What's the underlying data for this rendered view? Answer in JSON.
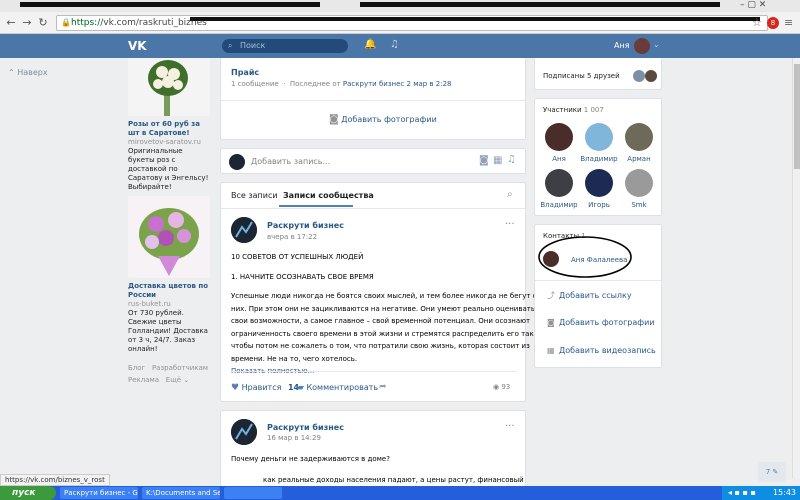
{
  "browser": {
    "url_host": "vk.com",
    "url_path": "/raskruti_biznes",
    "url_scheme": "https://",
    "ext_badge": "8"
  },
  "vk_header": {
    "logo": "VK",
    "search_placeholder": "Поиск",
    "user_name": "Аня"
  },
  "left": {
    "back_label": "Наверх",
    "ads": [
      {
        "title": "Розы от 60 руб за шт в Саратове!",
        "domain": "mirovetov-saratov.ru",
        "text": "Оригинальные букеты роз с доставкой по Саратову и Энгельсу! Выбирайте!"
      },
      {
        "title": "Доставка цветов по России",
        "domain": "rus-buket.ru",
        "text": "От 730 рублей. Свежие цветы Голландии! Доставка от 3 ч, 24/7. Заказ онлайн!"
      }
    ],
    "links": {
      "blog": "Блог",
      "devs": "Разработчикам",
      "ads": "Реклама",
      "more": "Ещё ⌄"
    }
  },
  "center": {
    "topic_card": {
      "title": "Прайс",
      "meta_count": "1 сообщение",
      "meta_last": "Последнее от",
      "meta_author": "Раскрути бизнес",
      "meta_date": "2 мар в 2:28",
      "add_photos": "Добавить фотографии"
    },
    "composer_placeholder": "Добавить запись...",
    "tabs": {
      "all": "Все записи",
      "community": "Записи сообщества"
    },
    "post1": {
      "author": "Раскрути бизнес",
      "time": "вчера в 17:22",
      "line1": "10 СОВЕТОВ ОТ УСПЕШНЫХ ЛЮДЕЙ",
      "line2": "1. НАЧНИТЕ ОСОЗНАВАТЬ СВОЕ ВРЕМЯ",
      "para": [
        "Успешные люди никогда не боятся своих мыслей, и тем более никогда не бегут от",
        "них. При этом они не зацикливаются на негативе. Они умеют реально оценивать",
        "свои возможности, а самое главное – свой временной потенциал. Они осознают",
        "ограниченность своего времени в этой жизни и стремятся распределить его так,",
        "чтобы потом не сожалеть о том, что потратили свою жизнь, которая состоит из",
        "времени. Не на то, чего хотелось."
      ],
      "more": "Показать полностью...",
      "likes_label": "Нравится",
      "likes_count": "14",
      "comment_label": "Комментировать",
      "views": "93"
    },
    "post2": {
      "author": "Раскрути бизнес",
      "time": "16 мар в 14:29",
      "line1": "Почему деньги не задерживаются в доме?",
      "line2": "как реальные доходы населения падают, а цены растут, финансовый"
    }
  },
  "right": {
    "subscribed": "Подписаны 5 друзей",
    "members_label": "Участники",
    "members_count": "1 007",
    "members": [
      "Аня",
      "Владимир",
      "Арман",
      "Владимир",
      "Игорь",
      "Smk"
    ],
    "contacts_label": "Контакты",
    "contacts_count": "1",
    "contact_name": "Аня Фалалеева",
    "actions": [
      "Добавить ссылку",
      "Добавить фотографии",
      "Добавить видеозапись"
    ]
  },
  "status_url": "https://vk.com/biznes_v_rost",
  "chat_count": "7",
  "taskbar": {
    "start": "пуск",
    "tasks": [
      "Раскрути бизнес - G...",
      "K:\\Documents and Se...",
      ""
    ],
    "clock": "15:43"
  }
}
